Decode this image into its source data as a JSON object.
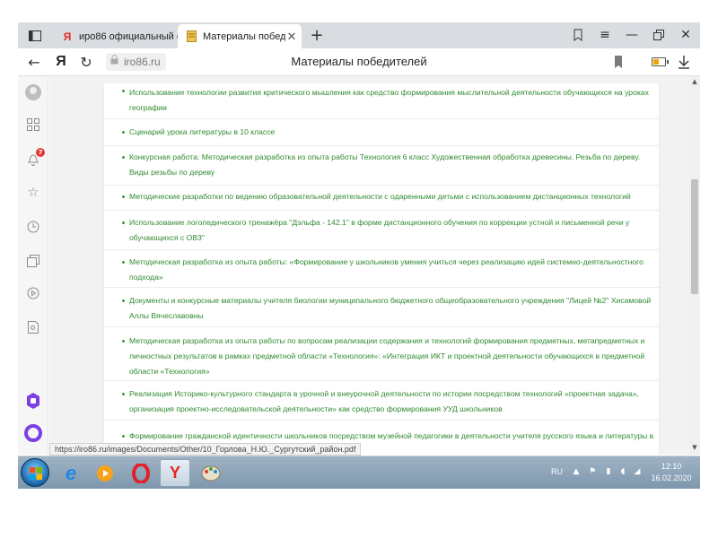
{
  "browser": {
    "tabs": [
      {
        "label": "иро86 официальный сайт",
        "favicon": "yandex-y-icon",
        "active": false
      },
      {
        "label": "Материалы победителей",
        "favicon": "document-icon",
        "active": true
      }
    ],
    "address": {
      "domain": "iro86.ru",
      "page_title": "Материалы победителей"
    },
    "status_url": "https://iro86.ru/images/Documents/Other/10_Горлова_Н.Ю._Сургутский_район.pdf"
  },
  "sidebar": {
    "icons": [
      "avatar",
      "grid-icon",
      "bell-icon",
      "star-icon",
      "clock-icon",
      "collections-icon",
      "play-icon",
      "search-doc-icon",
      "alice-icon",
      "alice-voice-icon"
    ],
    "notification_count": "7"
  },
  "content": {
    "items": [
      "Использование технологии развития критического мышления как средство формирования мыслительной деятельности обучающихся на уроках географии",
      "Сценарий урока литературы в 10 классе",
      "Конкурсная работа: Методическая разработка из опыта работы Технология 6 класс Художественная обработка древесины. Резьба по дереву. Виды резьбы по дереву",
      "Методические разработки по ведению образовательной деятельности с одаренными детьми с использованием дистанционных технологий",
      "Использование логопедического тренажёра \"Дэльфа - 142.1\" в форме дистанционного обучения по коррекции устной и письменной речи у обучающихся с ОВЗ\"",
      "Методическая разработка из опыта работы: «Формирование у школьников умения учиться через реализацию идей системно-деятельностного подхода»",
      "Документы и конкурсные материалы учителя биологии муниципального бюджетного общеобразовательного учреждения \"Лицей №2\" Хисамовой Аллы Вячеславовны",
      "Методическая разработка из опыта работы по вопросам реализации содержания и технологий формирования предметных, метапредметных и личностных результатов в рамках предметной области «Технология»: «Интеграция ИКТ и проектной деятельности обучающихся в предметной области «Технология»",
      "Реализация Историко-культурного стандарта в урочной и внеурочной деятельности по истории посредством технологий «проектная задача», организация проектно-исследовательской деятельности» как средство формирования УУД школьников",
      "Формирование гражданской идентичности школьников посредством музейной педагогики в деятельности учителя русского языка и литературы в"
    ],
    "link_color": "#2f8a2f"
  },
  "taskbar": {
    "apps": [
      "ie-icon",
      "media-player-icon",
      "opera-icon",
      "yandex-browser-icon",
      "paint-icon"
    ],
    "language": "RU",
    "time": "12:10",
    "date": "16.02.2020"
  }
}
